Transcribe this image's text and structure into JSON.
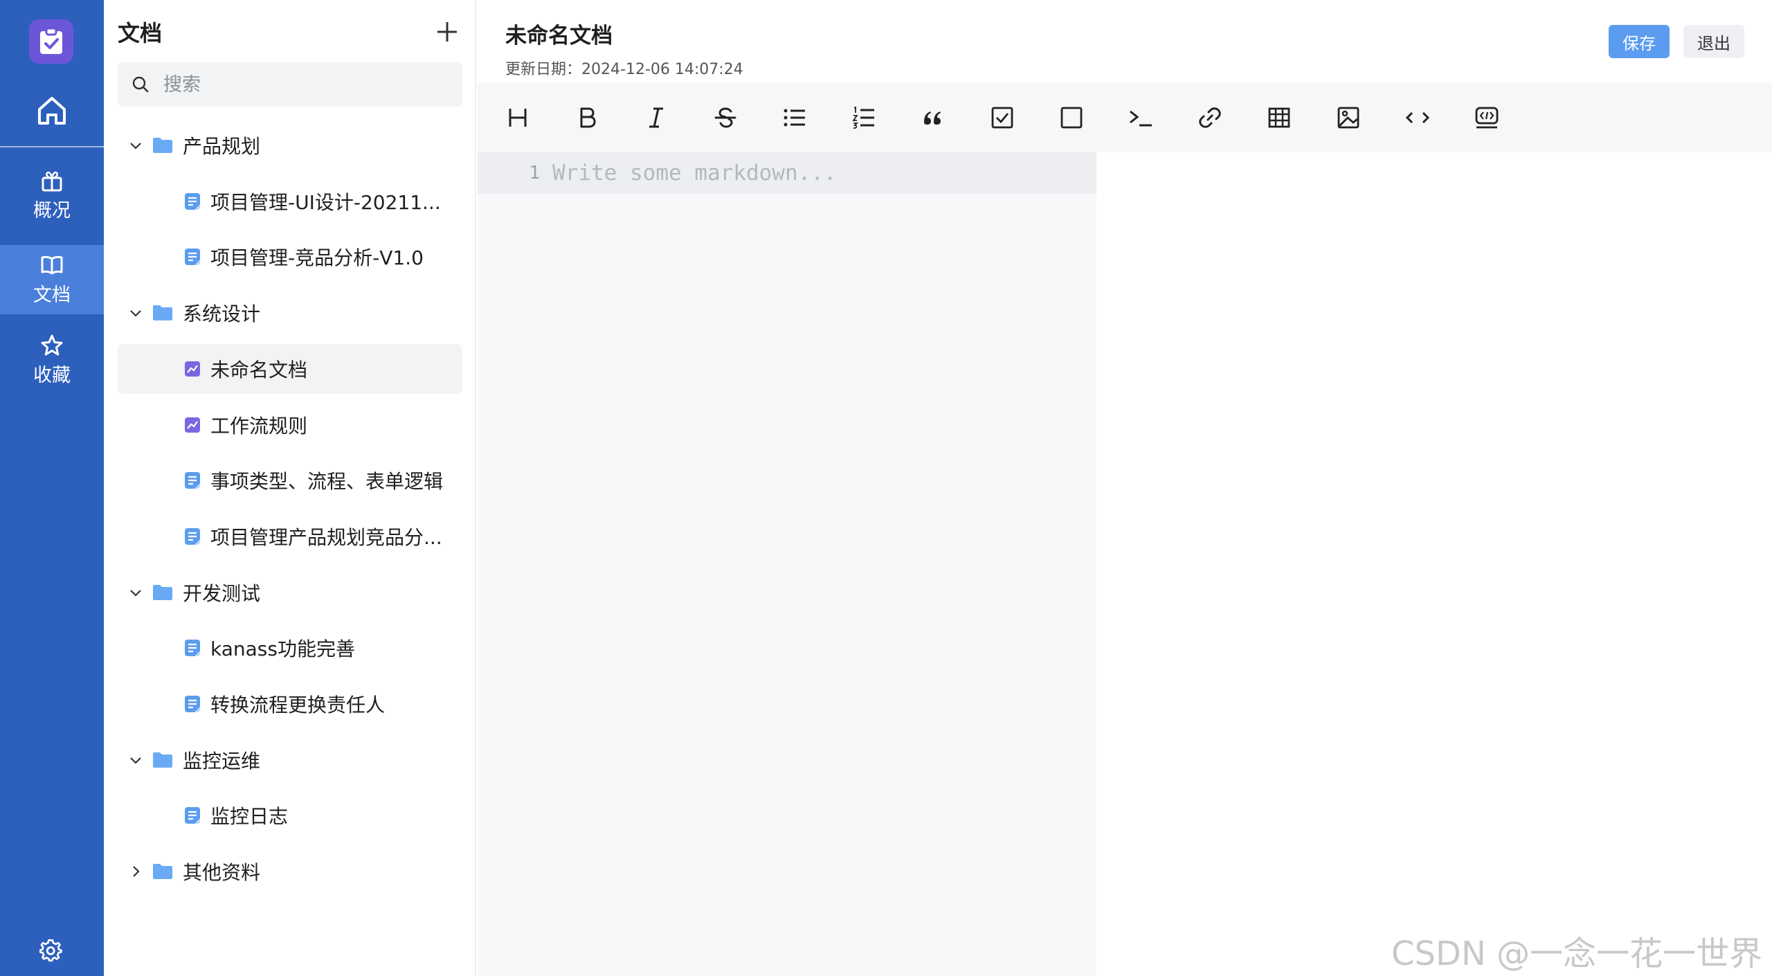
{
  "rail": {
    "nav": [
      {
        "id": "overview",
        "label": "概况",
        "icon": "gift-icon"
      },
      {
        "id": "docs",
        "label": "文档",
        "icon": "book-open-icon",
        "active": true
      },
      {
        "id": "favorites",
        "label": "收藏",
        "icon": "star-icon"
      }
    ]
  },
  "tree": {
    "title": "文档",
    "search_placeholder": "搜索",
    "folders": [
      {
        "name": "产品规划",
        "expanded": true,
        "docs": [
          {
            "name": "项目管理-UI设计-20211...",
            "type": "document"
          },
          {
            "name": "项目管理-竞品分析-V1.0",
            "type": "document"
          }
        ]
      },
      {
        "name": "系统设计",
        "expanded": true,
        "docs": [
          {
            "name": "未命名文档",
            "type": "markdown",
            "selected": true
          },
          {
            "name": "工作流规则",
            "type": "markdown"
          },
          {
            "name": "事项类型、流程、表单逻辑",
            "type": "document"
          },
          {
            "name": "项目管理产品规划竞品分...",
            "type": "document"
          }
        ]
      },
      {
        "name": "开发测试",
        "expanded": true,
        "docs": [
          {
            "name": "kanass功能完善",
            "type": "document"
          },
          {
            "name": "转换流程更换责任人",
            "type": "document"
          }
        ]
      },
      {
        "name": "监控运维",
        "expanded": true,
        "docs": [
          {
            "name": "监控日志",
            "type": "document"
          }
        ]
      },
      {
        "name": "其他资料",
        "expanded": false,
        "docs": []
      }
    ]
  },
  "editor": {
    "title": "未命名文档",
    "updated": "更新日期：2024-12-06 14:07:24",
    "save_label": "保存",
    "exit_label": "退出",
    "toolbar": [
      "heading-icon",
      "bold-icon",
      "italic-icon",
      "strikethrough-icon",
      "bullet-list-icon",
      "ordered-list-icon",
      "quote-icon",
      "checkbox-checked-icon",
      "checkbox-empty-icon",
      "terminal-icon",
      "link-icon",
      "table-icon",
      "image-icon",
      "code-icon",
      "code-block-icon"
    ],
    "line_number": "1",
    "placeholder": "Write some markdown..."
  },
  "watermark": "CSDN @一念一花一世界",
  "colors": {
    "rail": "#2d5fbd",
    "rail_active": "#4a7fdc",
    "primary": "#5b9cf0",
    "folder": "#6aaaf5",
    "doc_icon": "#5b9cf0",
    "md_icon": "#7b66e0"
  }
}
